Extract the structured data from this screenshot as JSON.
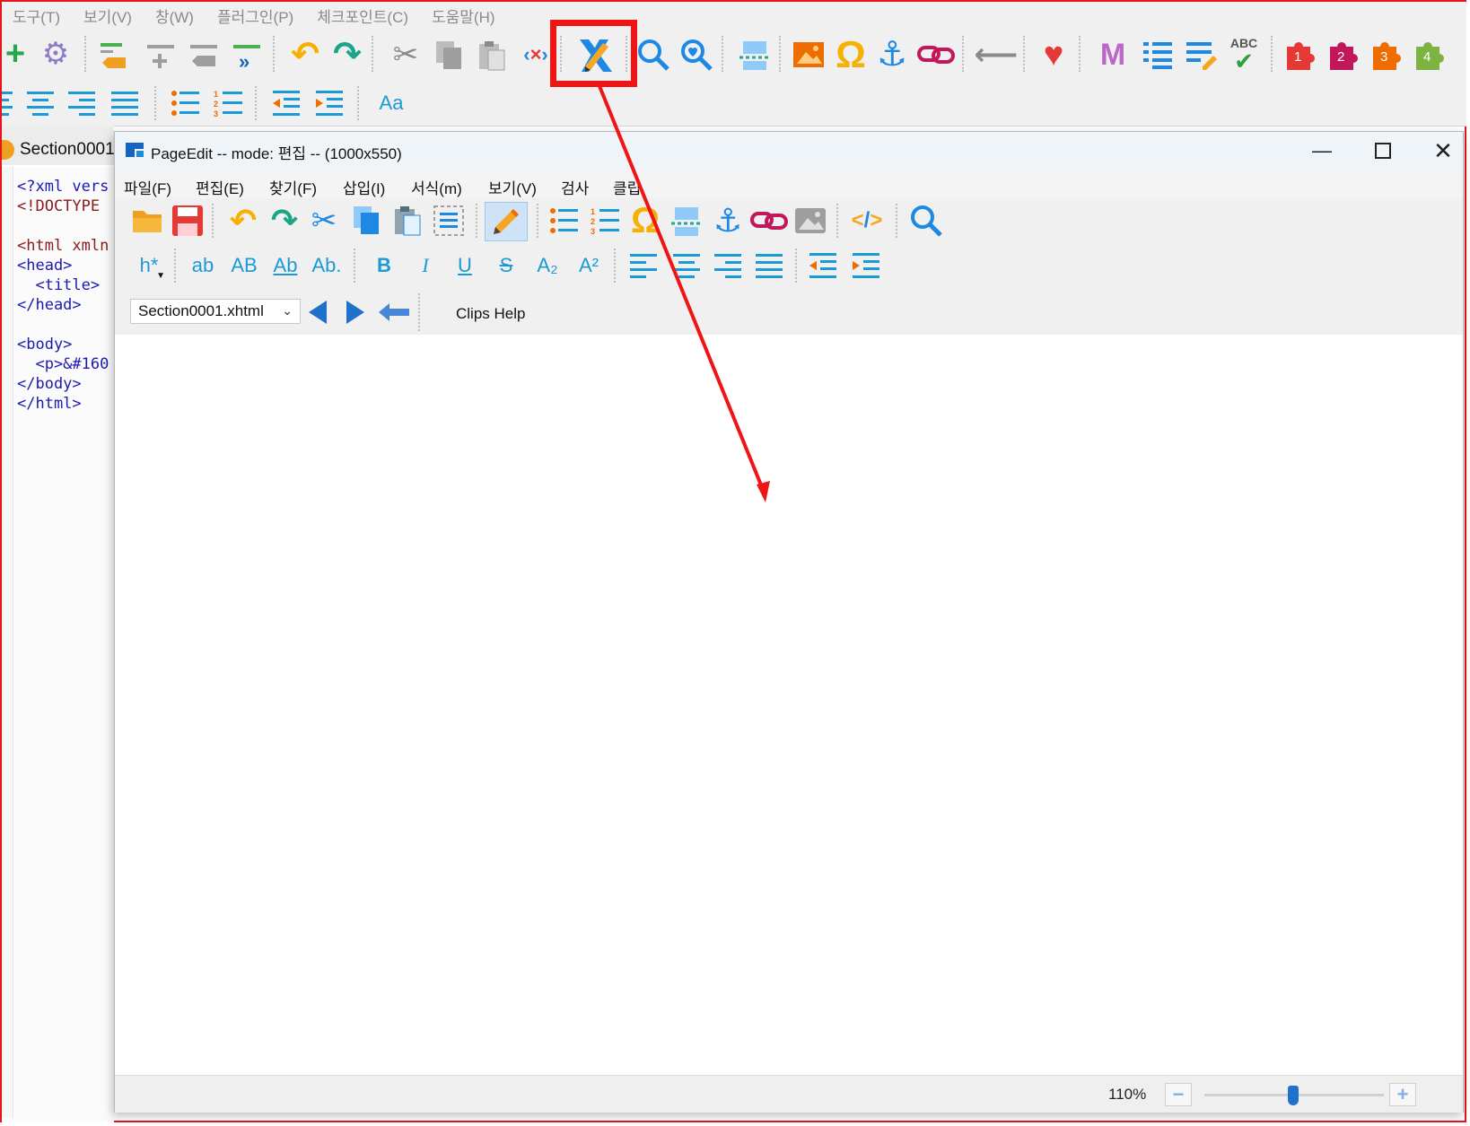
{
  "main_app": {
    "menu": [
      "도구(T)",
      "보기(V)",
      "창(W)",
      "플러그인(P)",
      "체크포인트(C)",
      "도움말(H)"
    ],
    "tab_label": "Section0001.",
    "code_lines": [
      "<?xml vers",
      "<!DOCTYPE ",
      "",
      "<html xmln",
      "<head>",
      "  <title>",
      "</head>",
      "",
      "<body>",
      "  <p>&#160",
      "</body>",
      "</html>"
    ],
    "font_button": "Aa",
    "plugin_numbers": [
      "1",
      "2",
      "3",
      "4"
    ],
    "spell_label": "ABC"
  },
  "pageedit": {
    "title": "PageEdit -- mode: 편집 -- (1000x550)",
    "menu": [
      "파일(F)",
      "편집(E)",
      "찾기(F)",
      "삽입(I)",
      "서식(m)",
      "보기(V)",
      "검사",
      "클립"
    ],
    "format_buttons": {
      "heading": "h*",
      "lowercase": "ab",
      "uppercase": "AB",
      "titlecase": "Ab",
      "sentencecase": "Ab.",
      "bold": "B",
      "italic": "I",
      "underline": "U",
      "strike": "S",
      "subscript": "A₂",
      "superscript": "A²"
    },
    "file_select": "Section0001.xhtml",
    "clips_help": "Clips Help",
    "zoom": "110%"
  },
  "colors": {
    "annotation": "#f01414",
    "accent_blue": "#1e88e5",
    "icon_cyan": "#1a9ad6"
  }
}
